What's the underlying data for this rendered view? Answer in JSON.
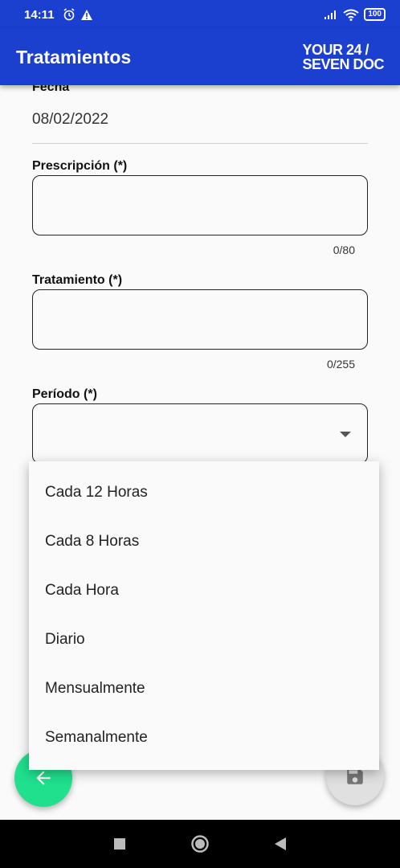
{
  "status_bar": {
    "time": "14:11",
    "battery": "100"
  },
  "app_bar": {
    "title": "Tratamientos",
    "logo_line1": "YOUR 24 /",
    "logo_line2": "SEVEN DOC"
  },
  "form": {
    "date_label": "Fecha",
    "date_value": "08/02/2022",
    "prescription_label": "Prescripción (*)",
    "prescription_value": "",
    "prescription_counter": "0/80",
    "treatment_label": "Tratamiento (*)",
    "treatment_value": "",
    "treatment_counter": "0/255",
    "period_label": "Período (*)",
    "period_value": ""
  },
  "dropdown": {
    "options": [
      "Cada 12 Horas",
      "Cada 8 Horas",
      "Cada Hora",
      "Diario",
      "Mensualmente",
      "Semanalmente"
    ]
  },
  "colors": {
    "primary": "#1b3fcf",
    "fab_accent": "#20e08e",
    "fab_disabled": "#e0e0e0"
  },
  "icons": {
    "back": "arrow-left-icon",
    "save": "save-icon",
    "dropdown": "caret-down-icon",
    "nav_recents": "square-icon",
    "nav_home": "circle-icon",
    "nav_back": "triangle-back-icon"
  }
}
